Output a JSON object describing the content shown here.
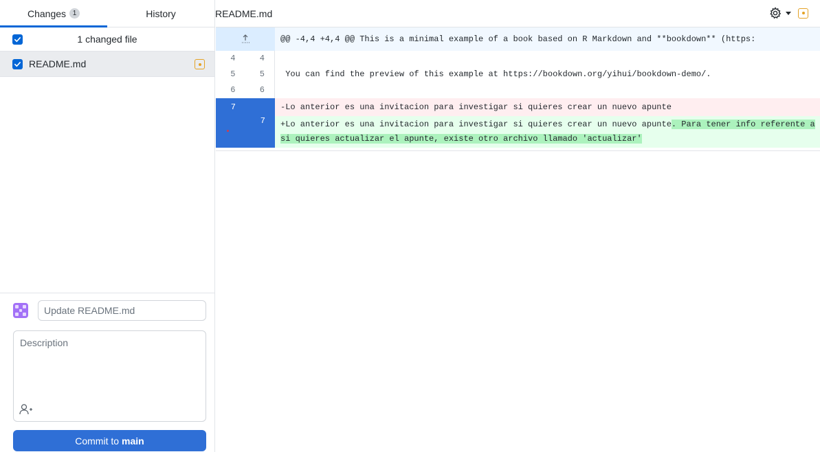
{
  "tabs": [
    {
      "label": "Changes",
      "badge": "1"
    },
    {
      "label": "History"
    }
  ],
  "changes": {
    "count_label": "1 changed file",
    "files": [
      {
        "name": "README.md",
        "status": "modified"
      }
    ]
  },
  "commit": {
    "summary_placeholder": "Update README.md",
    "description_placeholder": "Description",
    "button_prefix": "Commit to",
    "branch": "main"
  },
  "diff": {
    "file_path": "README.md",
    "hunk_header": "@@ -4,4 +4,4 @@ This is a minimal example of a book based on R Markdown and **bookdown** (https:",
    "lines": [
      {
        "old": "4",
        "new": "4",
        "text": ""
      },
      {
        "old": "5",
        "new": "5",
        "text": " You can find the preview of this example at https://bookdown.org/yihui/bookdown-demo/."
      },
      {
        "old": "6",
        "new": "6",
        "text": ""
      }
    ],
    "deleted": {
      "old": "7",
      "text": "-Lo anterior es una invitacion para investigar si quieres crear un nuevo apunte"
    },
    "added": {
      "new": "7",
      "text_plain": "+Lo anterior es una invitacion para investigar si quieres crear un nuevo apunte",
      "text_highlight": ". Para tener info referente a si quieres actualizar el apunte, existe otro archivo llamado 'actualizar' "
    }
  },
  "colors": {
    "accent": "#0366d6",
    "commit_button": "#2f6fd6",
    "modified": "#e4a225",
    "deleted_bg": "#ffeef0",
    "added_bg": "#e6ffed",
    "added_highlight": "#acf2bd"
  },
  "icons": {
    "settings": "gear-icon",
    "modified": "modified-icon",
    "expand": "expand-up-icon",
    "coauthor": "add-coauthor-icon"
  }
}
